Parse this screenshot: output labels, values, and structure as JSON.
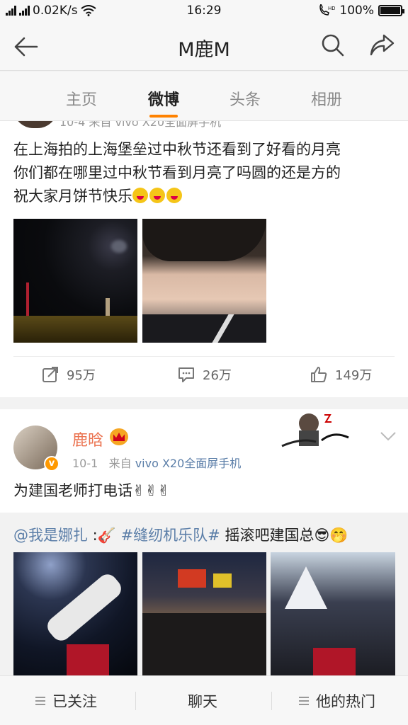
{
  "status_bar": {
    "network": "0.02K/s",
    "time": "16:29",
    "battery": "100%",
    "battery_level": 1.0
  },
  "header": {
    "title": "M鹿M"
  },
  "tabs": [
    {
      "label": "主页",
      "active": false
    },
    {
      "label": "微博",
      "active": true
    },
    {
      "label": "头条",
      "active": false
    },
    {
      "label": "相册",
      "active": false
    }
  ],
  "post1": {
    "meta_partial": "10-4  来自 vivo X20全面屏手机",
    "text_line1": "在上海拍的上海堡垒过中秋节还看到了好看的月亮",
    "text_line2": "你们都在哪里过中秋节看到月亮了吗圆的还是方的",
    "text_line3": "祝大家月饼节快乐",
    "reposts": "95万",
    "comments": "26万",
    "likes": "149万"
  },
  "post2": {
    "username": "鹿晗",
    "date": "10-1",
    "source_prefix": "来自",
    "device": "vivo X20全面屏手机",
    "text": "为建国老师打电话✌✌✌"
  },
  "repost": {
    "mention": "@我是娜扎",
    "mention_suffix": " :🎸 ",
    "hashtag": "#缝纫机乐队#",
    "rest": " 摇滚吧建国总😎🤭"
  },
  "bottom_bar": {
    "follow": "已关注",
    "chat": "聊天",
    "hot": "他的热门"
  },
  "colors": {
    "accent": "#ff8200",
    "username": "#eb7350",
    "link": "#5b7ea8"
  }
}
